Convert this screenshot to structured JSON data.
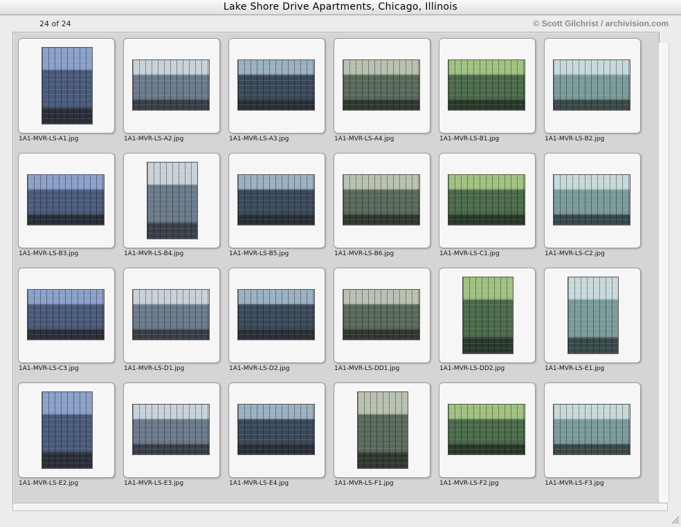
{
  "window": {
    "title": "Lake Shore Drive Apartments, Chicago, Illinois",
    "counter": "24 of 24",
    "credit": "© Scott Gilchrist / archivision.com"
  },
  "colors": {
    "panel_bg": "#d5d5d5",
    "frame_bg": "#f6f6f6",
    "credit_gray": "#8a8a8a"
  },
  "thumbnails": [
    {
      "name": "1A1-MVR-LS-A1.jpg",
      "orientation": "portrait"
    },
    {
      "name": "1A1-MVR-LS-A2.jpg",
      "orientation": "landscape"
    },
    {
      "name": "1A1-MVR-LS-A3.jpg",
      "orientation": "landscape"
    },
    {
      "name": "1A1-MVR-LS-A4.jpg",
      "orientation": "landscape"
    },
    {
      "name": "1A1-MVR-LS-B1.jpg",
      "orientation": "landscape"
    },
    {
      "name": "1A1-MVR-LS-B2.jpg",
      "orientation": "landscape"
    },
    {
      "name": "1A1-MVR-LS-B3.jpg",
      "orientation": "landscape"
    },
    {
      "name": "1A1-MVR-LS-B4.jpg",
      "orientation": "portrait"
    },
    {
      "name": "1A1-MVR-LS-B5.jpg",
      "orientation": "landscape"
    },
    {
      "name": "1A1-MVR-LS-B6.jpg",
      "orientation": "landscape"
    },
    {
      "name": "1A1-MVR-LS-C1.jpg",
      "orientation": "landscape"
    },
    {
      "name": "1A1-MVR-LS-C2.jpg",
      "orientation": "landscape"
    },
    {
      "name": "1A1-MVR-LS-C3.jpg",
      "orientation": "landscape"
    },
    {
      "name": "1A1-MVR-LS-D1.jpg",
      "orientation": "landscape"
    },
    {
      "name": "1A1-MVR-LS-D2.jpg",
      "orientation": "landscape"
    },
    {
      "name": "1A1-MVR-LS-DD1.jpg",
      "orientation": "landscape"
    },
    {
      "name": "1A1-MVR-LS-DD2.jpg",
      "orientation": "portrait"
    },
    {
      "name": "1A1-MVR-LS-E1.jpg",
      "orientation": "portrait"
    },
    {
      "name": "1A1-MVR-LS-E2.jpg",
      "orientation": "portrait"
    },
    {
      "name": "1A1-MVR-LS-E3.jpg",
      "orientation": "landscape"
    },
    {
      "name": "1A1-MVR-LS-E4.jpg",
      "orientation": "landscape"
    },
    {
      "name": "1A1-MVR-LS-F1.jpg",
      "orientation": "portrait"
    },
    {
      "name": "1A1-MVR-LS-F2.jpg",
      "orientation": "landscape"
    },
    {
      "name": "1A1-MVR-LS-F3.jpg",
      "orientation": "landscape"
    }
  ]
}
